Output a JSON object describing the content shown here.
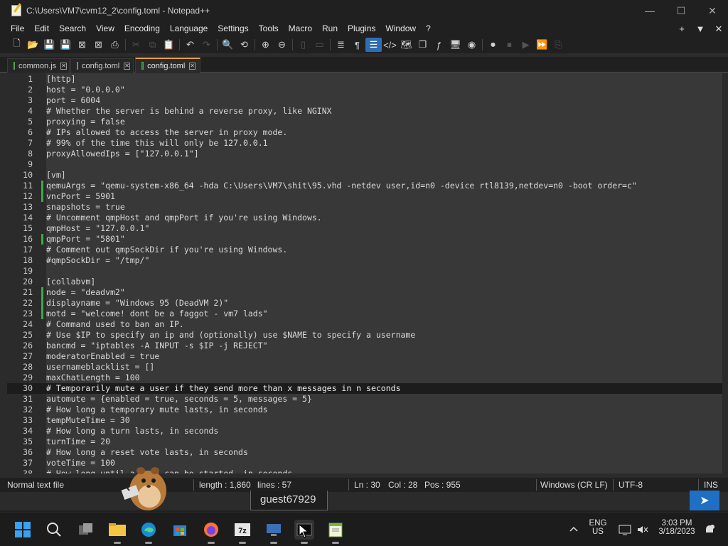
{
  "window": {
    "title": "C:\\Users\\VM7\\cvm12_2\\config.toml - Notepad++",
    "minimize": "—",
    "maximize": "☐",
    "close": "✕"
  },
  "menu": {
    "items": [
      "File",
      "Edit",
      "Search",
      "View",
      "Encoding",
      "Language",
      "Settings",
      "Tools",
      "Macro",
      "Run",
      "Plugins",
      "Window",
      "?"
    ],
    "right": [
      "+",
      "▼",
      "✕"
    ]
  },
  "toolbar": {
    "icons": [
      "new-file-icon",
      "open-icon",
      "save-icon",
      "save-all-icon",
      "close-icon",
      "close-all-icon",
      "print-icon",
      "cut-icon",
      "copy-icon",
      "paste-icon",
      "undo-icon",
      "redo-icon",
      "find-icon",
      "replace-icon",
      "zoom-in-icon",
      "zoom-out-icon",
      "sync-vertical-icon",
      "sync-horizontal-icon",
      "word-wrap-icon",
      "show-all-chars-icon",
      "indent-guide-icon",
      "xml-tag-icon",
      "document-map-icon",
      "document-list-icon",
      "function-list-icon",
      "folder-workspace-icon",
      "monitoring-icon",
      "record-macro-icon",
      "stop-record-icon",
      "play-macro-icon",
      "run-macro-multiple-icon",
      "save-macro-icon"
    ]
  },
  "tabs": [
    {
      "label": "common.js",
      "active": false
    },
    {
      "label": "config.toml",
      "active": false
    },
    {
      "label": "config.toml",
      "active": true
    }
  ],
  "editor": {
    "current_line": 30,
    "lines": [
      {
        "n": "1",
        "t": "[http]",
        "m": false
      },
      {
        "n": "2",
        "t": "host = \"0.0.0.0\"",
        "m": false
      },
      {
        "n": "3",
        "t": "port = 6004",
        "m": false
      },
      {
        "n": "4",
        "t": "# Whether the server is behind a reverse proxy, like NGINX",
        "m": false
      },
      {
        "n": "5",
        "t": "proxying = false",
        "m": false
      },
      {
        "n": "6",
        "t": "# IPs allowed to access the server in proxy mode.",
        "m": false
      },
      {
        "n": "7",
        "t": "# 99% of the time this will only be 127.0.0.1",
        "m": false
      },
      {
        "n": "8",
        "t": "proxyAllowedIps = [\"127.0.0.1\"]",
        "m": false
      },
      {
        "n": "9",
        "t": "",
        "m": false
      },
      {
        "n": "10",
        "t": "[vm]",
        "m": false
      },
      {
        "n": "11",
        "t": "qemuArgs = \"qemu-system-x86_64 -hda C:\\Users\\VM7\\shit\\95.vhd -netdev user,id=n0 -device rtl8139,netdev=n0 -boot order=c\"",
        "m": true
      },
      {
        "n": "12",
        "t": "vncPort = 5901",
        "m": true
      },
      {
        "n": "13",
        "t": "snapshots = true",
        "m": false
      },
      {
        "n": "14",
        "t": "# Uncomment qmpHost and qmpPort if you're using Windows.",
        "m": false
      },
      {
        "n": "15",
        "t": "qmpHost = \"127.0.0.1\"",
        "m": false
      },
      {
        "n": "16",
        "t": "qmpPort = \"5801\"",
        "m": true
      },
      {
        "n": "17",
        "t": "# Comment out qmpSockDir if you're using Windows.",
        "m": false
      },
      {
        "n": "18",
        "t": "#qmpSockDir = \"/tmp/\"",
        "m": false
      },
      {
        "n": "19",
        "t": "",
        "m": false
      },
      {
        "n": "20",
        "t": "[collabvm]",
        "m": false
      },
      {
        "n": "21",
        "t": "node = \"deadvm2\"",
        "m": true
      },
      {
        "n": "22",
        "t": "displayname = \"Windows 95 (DeadVM 2)\"",
        "m": true
      },
      {
        "n": "23",
        "t": "motd = \"welcome! dont be a faggot - vm7 lads\"",
        "m": true
      },
      {
        "n": "24",
        "t": "# Command used to ban an IP.",
        "m": false
      },
      {
        "n": "25",
        "t": "# Use $IP to specify an ip and (optionally) use $NAME to specify a username",
        "m": false
      },
      {
        "n": "26",
        "t": "bancmd = \"iptables -A INPUT -s $IP -j REJECT\"",
        "m": false
      },
      {
        "n": "27",
        "t": "moderatorEnabled = true",
        "m": false
      },
      {
        "n": "28",
        "t": "usernameblacklist = []",
        "m": false
      },
      {
        "n": "29",
        "t": "maxChatLength = 100",
        "m": false
      },
      {
        "n": "30",
        "t": "# Temporarily mute a user if they send more than x messages in n seconds",
        "m": false
      },
      {
        "n": "31",
        "t": "automute = {enabled = true, seconds = 5, messages = 5}",
        "m": false
      },
      {
        "n": "32",
        "t": "# How long a temporary mute lasts, in seconds",
        "m": false
      },
      {
        "n": "33",
        "t": "tempMuteTime = 30",
        "m": false
      },
      {
        "n": "34",
        "t": "# How long a turn lasts, in seconds",
        "m": false
      },
      {
        "n": "35",
        "t": "turnTime = 20",
        "m": false
      },
      {
        "n": "36",
        "t": "# How long a reset vote lasts, in seconds",
        "m": false
      },
      {
        "n": "37",
        "t": "voteTime = 100",
        "m": false
      },
      {
        "n": "38",
        "t": "# How long until a vote can be started, in seconds",
        "m": false
      }
    ]
  },
  "status": {
    "filetype": "Normal text file",
    "length": "length : 1,860",
    "lines": "lines : 57",
    "ln": "Ln : 30",
    "col": "Col : 28",
    "pos": "Pos : 955",
    "eol": "Windows (CR LF)",
    "encoding": "UTF-8",
    "mode": "INS"
  },
  "overlay": {
    "username": "guest67929"
  },
  "taskbar": {
    "apps": [
      "start-icon",
      "search-icon",
      "task-view-icon",
      "file-explorer-icon",
      "edge-icon",
      "store-icon",
      "firefox-icon",
      "7zip-icon",
      "remote-desktop-icon",
      "terminal-icon",
      "notepad-plus-plus-icon"
    ],
    "lang1": "ENG",
    "lang2": "US",
    "time": "3:03 PM",
    "date": "3/18/2023"
  },
  "colors": {
    "accent": "#2f6db3",
    "tab_active": "#e8a33b",
    "change_marker": "#3fa84a",
    "send_button": "#1f6fc4"
  }
}
